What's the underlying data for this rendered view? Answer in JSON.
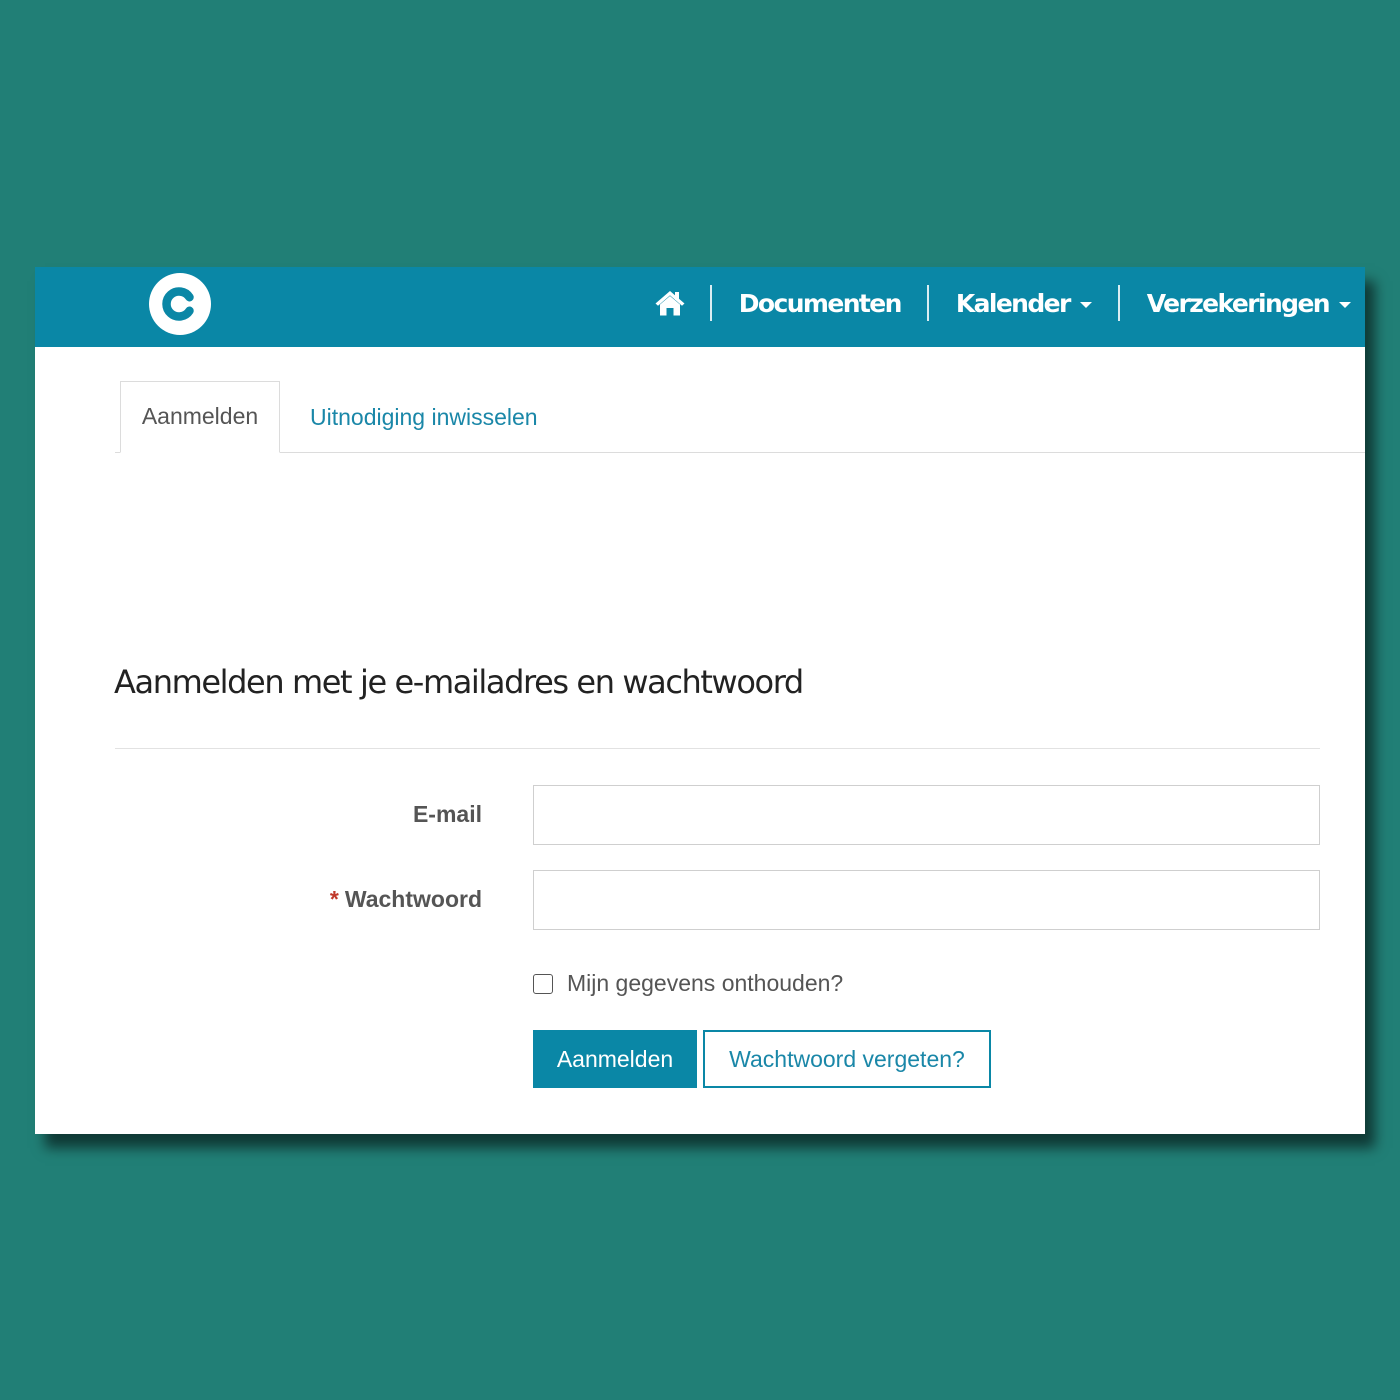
{
  "colors": {
    "page_background": "#217f76",
    "nav_background": "#0a87a6",
    "accent": "#0a87a6",
    "link": "#1a87a8",
    "required_marker": "#c0392b"
  },
  "header": {
    "logo_icon": "logo-c-icon",
    "home_icon": "home-icon",
    "nav": [
      {
        "label": "Documenten",
        "dropdown": false
      },
      {
        "label": "Kalender",
        "dropdown": true
      },
      {
        "label": "Verzekeringen",
        "dropdown": true
      }
    ]
  },
  "tabs": [
    {
      "label": "Aanmelden",
      "active": true
    },
    {
      "label": "Uitnodiging inwisselen",
      "active": false
    }
  ],
  "form": {
    "heading": "Aanmelden met je e-mailadres en wachtwoord",
    "email": {
      "label": "E-mail",
      "value": "",
      "required": false
    },
    "password": {
      "label": "Wachtwoord",
      "value": "",
      "required": true,
      "required_marker": "*"
    },
    "remember": {
      "label": "Mijn gegevens onthouden?",
      "checked": false
    },
    "submit_label": "Aanmelden",
    "forgot_label": "Wachtwoord vergeten?"
  }
}
